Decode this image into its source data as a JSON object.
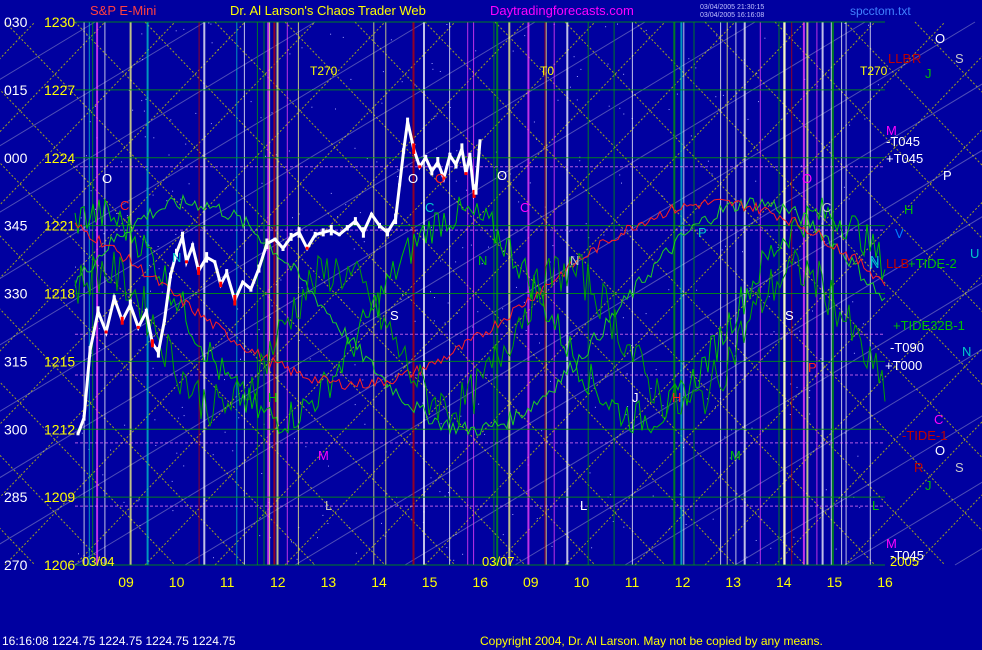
{
  "header": {
    "title_left": "S&P E-Mini",
    "title_center": "Dr. Al Larson's Chaos Trader Web",
    "site": "Daytradingforecasts.com",
    "stamp1": "03/04/2005 21:30:15",
    "stamp2": "03/04/2005 16:16:08",
    "filename": "spcctom.txt"
  },
  "footer": {
    "quote": "16:16:08  1224.75 1224.75 1224.75 1224.75",
    "copyright": "Copyright 2004, Dr. Al Larson. May not be copied by any means."
  },
  "colors": {
    "background": "#0000a0",
    "price_bar": "#ffffff",
    "down_bar": "#ff0000",
    "axis_text": "#ffff00",
    "grid_yellow": "#c8c800",
    "grid_green": "#00a000",
    "grid_white": "#ffffff",
    "grid_cyan": "#00c8c8",
    "grid_red": "#c00000",
    "magenta": "#ff00ff"
  },
  "chart_data": {
    "type": "line",
    "title": "S&P E-Mini",
    "ylabels_angle": [
      "030",
      "015",
      "000",
      "345",
      "330",
      "315",
      "300",
      "285",
      "270"
    ],
    "ylabels_price": [
      "1230",
      "1227",
      "1224",
      "1221",
      "1218",
      "1215",
      "1212",
      "1209",
      "1206"
    ],
    "ylim": [
      1206,
      1230
    ],
    "xlabels": [
      "09",
      "10",
      "11",
      "12",
      "13",
      "14",
      "15",
      "16",
      "09",
      "10",
      "11",
      "12",
      "13",
      "14",
      "15",
      "16"
    ],
    "date_labels": [
      "03/04",
      "03/07",
      "2005"
    ],
    "price_series": [
      [
        0.0,
        1211.8
      ],
      [
        0.015,
        1212.5
      ],
      [
        0.03,
        1215.5
      ],
      [
        0.05,
        1217.2
      ],
      [
        0.07,
        1216.3
      ],
      [
        0.09,
        1217.8
      ],
      [
        0.11,
        1216.8
      ],
      [
        0.13,
        1217.5
      ],
      [
        0.15,
        1216.5
      ],
      [
        0.17,
        1217.2
      ],
      [
        0.185,
        1215.8
      ],
      [
        0.2,
        1215.4
      ],
      [
        0.215,
        1216.8
      ],
      [
        0.23,
        1218.8
      ],
      [
        0.245,
        1219.8
      ],
      [
        0.26,
        1220.5
      ],
      [
        0.27,
        1219.4
      ],
      [
        0.285,
        1220.1
      ],
      [
        0.3,
        1219.0
      ],
      [
        0.32,
        1219.6
      ],
      [
        0.34,
        1219.4
      ],
      [
        0.355,
        1218.4
      ],
      [
        0.37,
        1218.9
      ],
      [
        0.39,
        1217.7
      ],
      [
        0.41,
        1218.5
      ],
      [
        0.43,
        1218.2
      ],
      [
        0.45,
        1219.1
      ],
      [
        0.47,
        1220.2
      ],
      [
        0.49,
        1220.4
      ],
      [
        0.51,
        1220.0
      ],
      [
        0.53,
        1220.5
      ],
      [
        0.55,
        1220.7
      ],
      [
        0.57,
        1220.0
      ],
      [
        0.59,
        1220.6
      ],
      [
        0.61,
        1220.7
      ],
      [
        0.63,
        1220.8
      ],
      [
        0.65,
        1220.6
      ],
      [
        0.67,
        1220.9
      ],
      [
        0.69,
        1221.2
      ],
      [
        0.71,
        1220.7
      ],
      [
        0.73,
        1221.5
      ],
      [
        0.75,
        1221.0
      ],
      [
        0.77,
        1220.7
      ],
      [
        0.79,
        1221.3
      ],
      [
        0.8,
        1222.8
      ],
      [
        0.81,
        1224.3
      ],
      [
        0.82,
        1225.6
      ],
      [
        0.835,
        1224.4
      ],
      [
        0.85,
        1223.6
      ],
      [
        0.865,
        1224.0
      ],
      [
        0.88,
        1223.4
      ],
      [
        0.895,
        1223.8
      ],
      [
        0.91,
        1223.1
      ],
      [
        0.925,
        1224.1
      ],
      [
        0.94,
        1223.7
      ],
      [
        0.955,
        1224.4
      ],
      [
        0.965,
        1223.3
      ],
      [
        0.975,
        1224.1
      ],
      [
        0.985,
        1222.4
      ],
      [
        0.99,
        1222.6
      ],
      [
        1.0,
        1224.75
      ]
    ],
    "ephemeris_lines_right": [
      {
        "label": "LLB",
        "color": "#c00000"
      },
      {
        "label": "R",
        "color": "#c00000"
      },
      {
        "label": "J",
        "color": "#00c000"
      },
      {
        "label": "O",
        "color": "#ffffff"
      },
      {
        "label": "S",
        "color": "#c8c8c8"
      },
      {
        "label": "M",
        "color": "#ff00ff"
      },
      {
        "label": "-T045",
        "color": "#ffffff"
      },
      {
        "label": "+T045",
        "color": "#ffffff"
      },
      {
        "label": "P",
        "color": "#ffffff"
      },
      {
        "label": "H",
        "color": "#00c000"
      },
      {
        "label": "V",
        "color": "#0080ff"
      },
      {
        "label": "N",
        "color": "#00c8c8"
      },
      {
        "label": "LLB",
        "color": "#c00000"
      },
      {
        "label": "+TIDE-2",
        "color": "#00c000"
      },
      {
        "label": "U",
        "color": "#00c8c8"
      },
      {
        "label": "+TIDE32B-1",
        "color": "#00c000"
      },
      {
        "label": "-T090",
        "color": "#ffffff"
      },
      {
        "label": "+T000",
        "color": "#ffffff"
      },
      {
        "label": "N",
        "color": "#00c8c8"
      },
      {
        "label": "C",
        "color": "#ff00ff"
      },
      {
        "label": "-TIDE-1",
        "color": "#c00000"
      },
      {
        "label": "O",
        "color": "#ffffff"
      },
      {
        "label": "R",
        "color": "#c00000"
      },
      {
        "label": "S",
        "color": "#c8c8c8"
      },
      {
        "label": "J",
        "color": "#00c000"
      },
      {
        "label": "M",
        "color": "#ff00ff"
      },
      {
        "label": "-T045",
        "color": "#ffffff"
      }
    ],
    "time_markers": [
      {
        "label": "T270",
        "color": "#ffff00"
      },
      {
        "label": "T0",
        "color": "#ffff00"
      },
      {
        "label": "T270",
        "color": "#ffff00"
      }
    ],
    "planet_letters_on_chart": [
      "O",
      "C",
      "N",
      "H",
      "S",
      "M",
      "L",
      "O",
      "O",
      "C",
      "N",
      "O",
      "C",
      "N",
      "J",
      "H",
      "P",
      "M",
      "L",
      "O",
      "C",
      "S",
      "P",
      "N",
      "L"
    ]
  }
}
